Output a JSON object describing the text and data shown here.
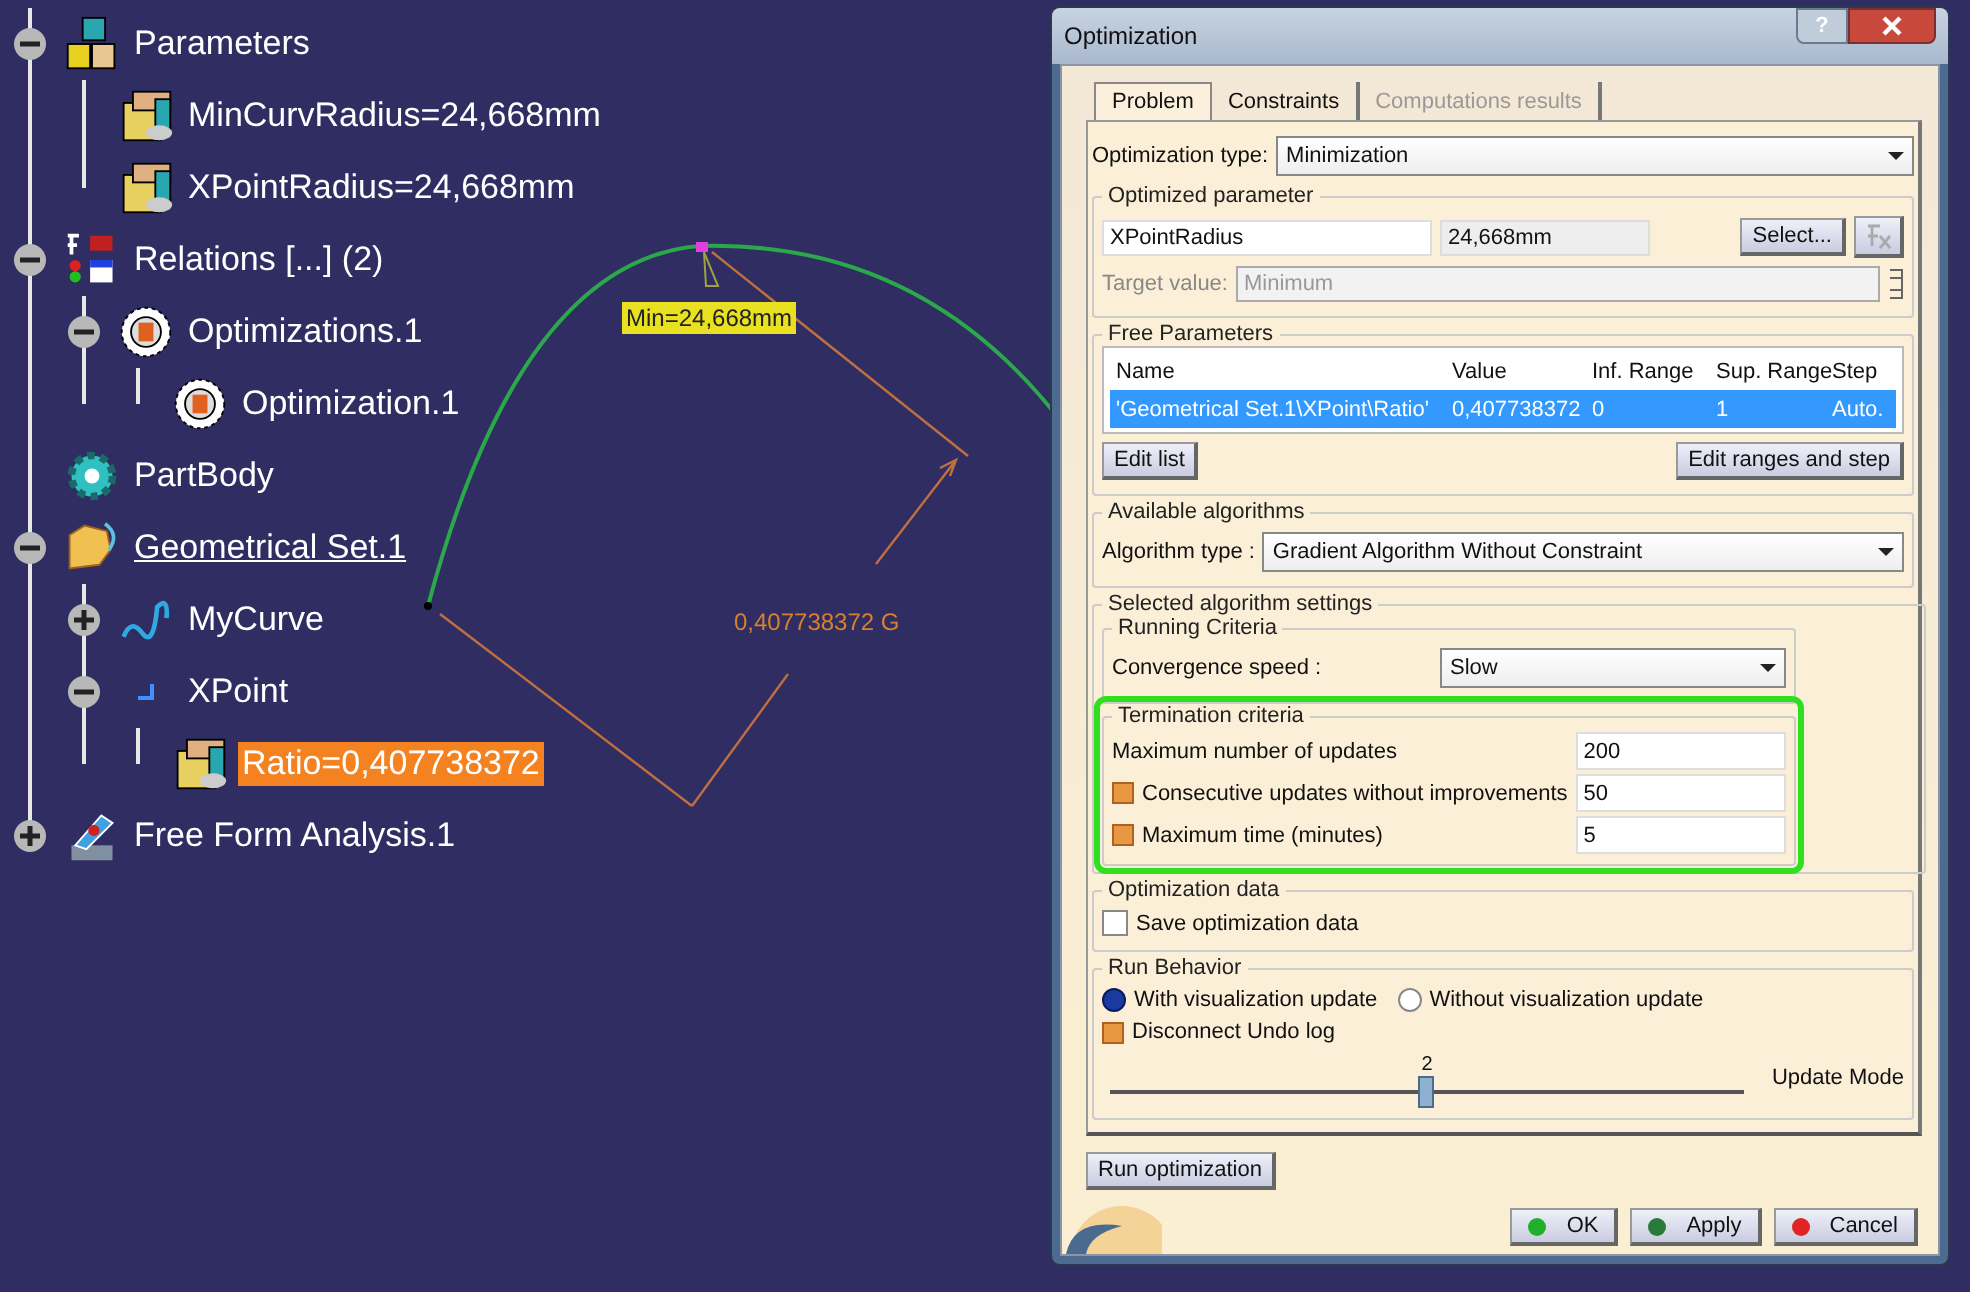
{
  "tree": [
    {
      "label": "Parameters",
      "kind": "parameters",
      "expanded": true,
      "selected": false,
      "in_work": false,
      "children": [
        {
          "label": "MinCurvRadius=24,668mm",
          "kind": "parameter",
          "selected": false,
          "in_work": false
        },
        {
          "label": "XPointRadius=24,668mm",
          "kind": "parameter",
          "selected": false,
          "in_work": false
        }
      ]
    },
    {
      "label": "Relations [...] (2)",
      "kind": "relations",
      "expanded": true,
      "selected": false,
      "in_work": false,
      "children": [
        {
          "label": "Optimizations.1",
          "kind": "optimization",
          "expanded": true,
          "selected": false,
          "in_work": false,
          "children": [
            {
              "label": "Optimization.1",
              "kind": "optimization",
              "selected": false,
              "in_work": false
            }
          ]
        }
      ]
    },
    {
      "label": "PartBody",
      "kind": "body",
      "selected": false,
      "in_work": false
    },
    {
      "label": "Geometrical Set.1",
      "kind": "geoset",
      "expanded": true,
      "selected": false,
      "in_work": true,
      "children": [
        {
          "label": "MyCurve",
          "kind": "curve",
          "expanded": false,
          "selected": false,
          "in_work": false
        },
        {
          "label": "XPoint",
          "kind": "point",
          "expanded": true,
          "selected": false,
          "in_work": false,
          "children": [
            {
              "label": "Ratio=0,407738372",
              "kind": "parameter",
              "selected": true,
              "in_work": false
            }
          ]
        }
      ]
    },
    {
      "label": "Free Form Analysis.1",
      "kind": "analysis",
      "expanded": false,
      "selected": false,
      "in_work": false
    }
  ],
  "canvas": {
    "min_label": "Min=24,668mm",
    "ratio_label": "0,407738372 G"
  },
  "dialog": {
    "title": "Optimization",
    "help": "?",
    "tabs": [
      {
        "label": "Problem",
        "selected": true,
        "disabled": false
      },
      {
        "label": "Constraints",
        "selected": false,
        "disabled": false
      },
      {
        "label": "Computations results",
        "selected": false,
        "disabled": true
      }
    ],
    "optimization_type": {
      "label": "Optimization type:",
      "value": "Minimization"
    },
    "optimized_parameter": {
      "title": "Optimized parameter",
      "name": "XPointRadius",
      "value": "24,668mm",
      "select_button": "Select...",
      "target_label": "Target value:",
      "target_value": "Minimum"
    },
    "free_parameters": {
      "title": "Free Parameters",
      "columns": [
        "Name",
        "Value",
        "Inf. Range",
        "Sup. Range",
        "Step"
      ],
      "rows": [
        {
          "cells": [
            "'Geometrical Set.1\\XPoint\\Ratio'",
            "0,407738372",
            "0",
            "1",
            "Auto."
          ],
          "selected": true
        }
      ],
      "buttons": [
        "Edit list",
        "Edit ranges and step"
      ]
    },
    "algorithms": {
      "title": "Available algorithms",
      "label": "Algorithm type :",
      "value": "Gradient Algorithm Without Constraint"
    },
    "settings": {
      "title": "Selected algorithm settings",
      "running": {
        "title": "Running Criteria",
        "label": "Convergence speed :",
        "value": "Slow"
      },
      "termination": {
        "title": "Termination criteria",
        "highlighted": true,
        "rows": [
          {
            "kind": "plain",
            "label": "Maximum number of updates",
            "value": "200"
          },
          {
            "kind": "checkbox",
            "checked": true,
            "label": "Consecutive updates without improvements",
            "value": "50"
          },
          {
            "kind": "checkbox",
            "checked": true,
            "label": "Maximum time (minutes)",
            "value": "5"
          }
        ]
      }
    },
    "optimization_data": {
      "title": "Optimization data",
      "checkbox": {
        "label": "Save optimization data",
        "checked": false
      }
    },
    "run_behavior": {
      "title": "Run Behavior",
      "radios": [
        {
          "label": "With visualization update",
          "selected": true
        },
        {
          "label": "Without visualization update",
          "selected": false
        }
      ],
      "undo": {
        "label": "Disconnect Undo log",
        "checked": true
      },
      "slider": {
        "value": "2",
        "level": 0.5,
        "label": "Update Mode"
      }
    },
    "run_button": "Run optimization",
    "buttons": [
      {
        "label": "OK",
        "color": "#22b02a"
      },
      {
        "label": "Apply",
        "color": "#2a7a3a"
      },
      {
        "label": "Cancel",
        "color": "#e02424"
      }
    ]
  }
}
